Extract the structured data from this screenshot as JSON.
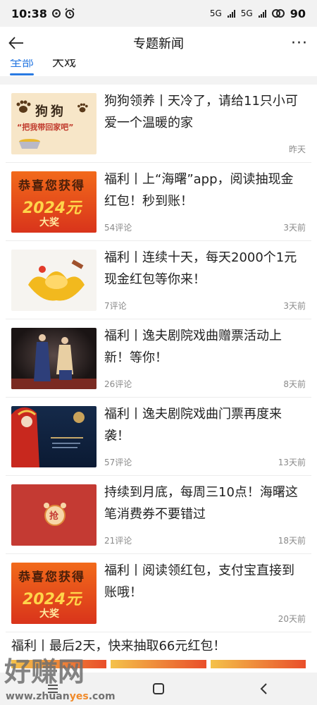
{
  "status": {
    "time": "10:38",
    "battery": "90",
    "net1": "5G",
    "net2": "5G"
  },
  "nav": {
    "title": "专题新闻",
    "more": "···"
  },
  "tabs": [
    {
      "label": "全部",
      "active": true
    },
    {
      "label": "大戏",
      "active": false
    }
  ],
  "news": [
    {
      "title": "狗狗领养丨天冷了，请给11只小可爱一个温暖的家",
      "comments": "",
      "date": "昨天",
      "thumb_text": "狗狗",
      "thumb_sub": "“把我带回家吧”"
    },
    {
      "title": "福利丨上“海曙”app，阅读抽现金红包！秒到账！",
      "comments": "54评论",
      "date": "3天前",
      "thumb_text": "恭喜您获得",
      "thumb_sub": "2024元",
      "thumb_sub2": "大奖"
    },
    {
      "title": "福利丨连续十天，每天2000个1元现金红包等你来！",
      "comments": "7评论",
      "date": "3天前"
    },
    {
      "title": "福利丨逸夫剧院戏曲赠票活动上新！等你！",
      "comments": "26评论",
      "date": "8天前"
    },
    {
      "title": "福利丨逸夫剧院戏曲门票再度来袭！",
      "comments": "57评论",
      "date": "13天前"
    },
    {
      "title": "持续到月底，每周三10点！海曙这笔消费券不要错过",
      "comments": "21评论",
      "date": "18天前",
      "thumb_text": "抢"
    },
    {
      "title": "福利丨阅读领红包，支付宝直接到账哦！",
      "comments": "",
      "date": "20天前",
      "thumb_text": "恭喜您获得",
      "thumb_sub": "2024元",
      "thumb_sub2": "大奖"
    }
  ],
  "last_item": {
    "title": "福利丨最后2天，快来抽取66元红包！"
  },
  "watermark": {
    "text": "好赚网",
    "url_a": "www.zhuan",
    "url_b": "yes",
    "url_c": ".com"
  }
}
